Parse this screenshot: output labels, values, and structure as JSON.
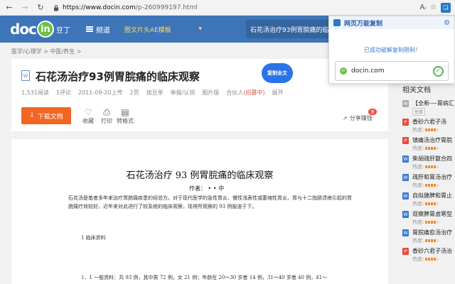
{
  "browser": {
    "back_icon": "back-arrow-icon",
    "forward_icon": "forward-arrow-icon",
    "refresh_icon": "refresh-icon",
    "url_scheme_host": "https://www.docin.com",
    "url_path": "/p-260999197.html"
  },
  "header": {
    "logo_text": "doc",
    "logo_badge": "in",
    "logo_cn": "豆丁",
    "channel_label": "频道",
    "category_label": "图文片头AE模板",
    "search_value": "石花汤治疗93例胃脘痛的临床观察"
  },
  "breadcrumb": "医学/心理学 > 中医/养生 >",
  "doc": {
    "title": "石花汤治疗93例胃脘痛的临床观察",
    "copy_button": "复制全文",
    "meta": [
      "1,531阅读",
      "1评论",
      "2011-09-20上传",
      "2页",
      "加豆单",
      "举报/认领",
      "图片版",
      "合伙人",
      "(招募中)",
      "展开"
    ],
    "download_label": "下载文档",
    "actions": [
      {
        "icon": "heart-icon",
        "label": "收藏"
      },
      {
        "icon": "printer-icon",
        "label": "打印"
      },
      {
        "icon": "convert-icon",
        "label": "转格式"
      }
    ],
    "share_label": "分享赚钱",
    "share_badge": "赏"
  },
  "page": {
    "title": "石花汤治疗 93 例胃脘痛的临床观察",
    "author": "作者： • • 中",
    "paragraph": "石花汤是笔者多年来治疗胃脘痛疾患的经验方。对于现代医学的急性胃炎、慢性浅表性或萎缩性胃炎、胃与十二指肠溃疡引起的胃脘痛疗效较好。近年来对此进行了较系统的临床观察，现将所观察的 93 例报道于下。",
    "section1": "1 临床资料",
    "section2": "1．1 一般资料：共 93 例，其中男 72 例，女 21 例；年龄在 20～30 岁者 14 例，31～40 岁者 40 例，41～"
  },
  "sidebar": {
    "title": "相关文档",
    "heat_label": "热度:",
    "items": [
      {
        "title": "【全新-—胃病汇",
        "kind": "tag",
        "tag": "豆单",
        "color": "#aaaaaa"
      },
      {
        "title": "香砂六君子汤",
        "kind": "heat",
        "color": "#e74c3c"
      },
      {
        "title": "镇痛汤治疗胃脘",
        "kind": "heat",
        "color": "#e74c3c"
      },
      {
        "title": "柴胡疏肝散合四",
        "kind": "heat",
        "color": "#3a7bd5"
      },
      {
        "title": "疏肝和胃汤治疗",
        "kind": "heat",
        "color": "#3a7bd5"
      },
      {
        "title": "自拟健脾和胃止",
        "kind": "heat",
        "color": "#3a7bd5"
      },
      {
        "title": "观察脾胃虚寒型",
        "kind": "heat",
        "color": "#3a7bd5"
      },
      {
        "title": "胃脘痛愈汤治疗",
        "kind": "heat",
        "color": "#3a7bd5"
      },
      {
        "title": "香砂六君子汤治",
        "kind": "heat",
        "color": "#e74c3c"
      }
    ]
  },
  "popup": {
    "title": "网页万能复制",
    "message": "已成功破解复制限制！",
    "site": "docin.com",
    "status_icon": "check-circle-icon",
    "settings_icon": "gear-icon"
  },
  "colors": {
    "header_bg": "#3e74b8",
    "download_bg": "#f26522",
    "copy_btn": "#2a73e8"
  }
}
